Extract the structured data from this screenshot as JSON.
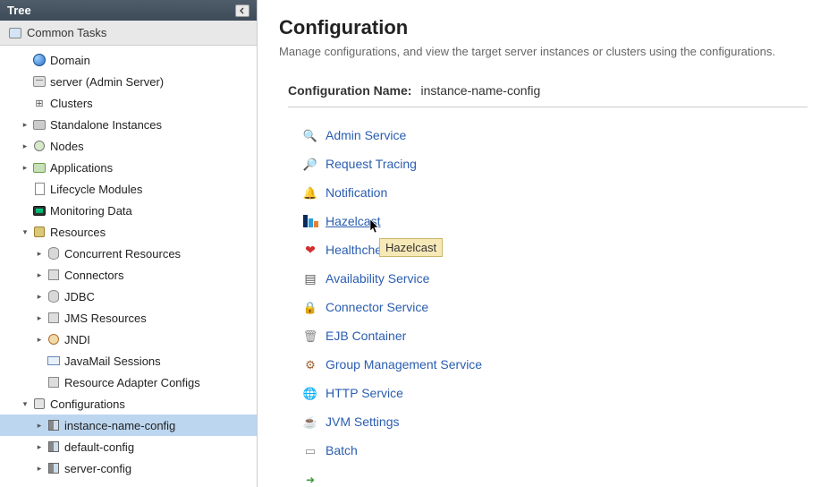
{
  "sidebar": {
    "header": "Tree",
    "common_tasks": "Common Tasks",
    "items": [
      {
        "label": "Domain",
        "indent": 1,
        "icon": "globe",
        "expander": ""
      },
      {
        "label": "server (Admin Server)",
        "indent": 1,
        "icon": "server",
        "expander": ""
      },
      {
        "label": "Clusters",
        "indent": 1,
        "icon": "cluster",
        "expander": ""
      },
      {
        "label": "Standalone Instances",
        "indent": 1,
        "icon": "folder",
        "expander": "▸"
      },
      {
        "label": "Nodes",
        "indent": 1,
        "icon": "nodes",
        "expander": "▸"
      },
      {
        "label": "Applications",
        "indent": 1,
        "icon": "app",
        "expander": "▸"
      },
      {
        "label": "Lifecycle Modules",
        "indent": 1,
        "icon": "doc",
        "expander": ""
      },
      {
        "label": "Monitoring Data",
        "indent": 1,
        "icon": "monitor",
        "expander": ""
      },
      {
        "label": "Resources",
        "indent": 1,
        "icon": "res",
        "expander": "▾"
      },
      {
        "label": "Concurrent Resources",
        "indent": 2,
        "icon": "db",
        "expander": "▸"
      },
      {
        "label": "Connectors",
        "indent": 2,
        "icon": "conn",
        "expander": "▸"
      },
      {
        "label": "JDBC",
        "indent": 2,
        "icon": "db",
        "expander": "▸"
      },
      {
        "label": "JMS Resources",
        "indent": 2,
        "icon": "conn",
        "expander": "▸"
      },
      {
        "label": "JNDI",
        "indent": 2,
        "icon": "jndi",
        "expander": "▸"
      },
      {
        "label": "JavaMail Sessions",
        "indent": 2,
        "icon": "mail",
        "expander": ""
      },
      {
        "label": "Resource Adapter Configs",
        "indent": 2,
        "icon": "conn",
        "expander": ""
      },
      {
        "label": "Configurations",
        "indent": 1,
        "icon": "config",
        "expander": "▾"
      },
      {
        "label": "instance-name-config",
        "indent": 2,
        "icon": "confitem",
        "expander": "▸",
        "selected": true
      },
      {
        "label": "default-config",
        "indent": 2,
        "icon": "confitem",
        "expander": "▸"
      },
      {
        "label": "server-config",
        "indent": 2,
        "icon": "confitem",
        "expander": "▸"
      }
    ]
  },
  "main": {
    "title": "Configuration",
    "subtitle": "Manage configurations, and view the target server instances or clusters using the configurations.",
    "config_name_label": "Configuration Name:",
    "config_name_value": "instance-name-config",
    "tooltip": "Hazelcast",
    "items": [
      {
        "label": "Admin Service",
        "icon": "admin"
      },
      {
        "label": "Request Tracing",
        "icon": "trace"
      },
      {
        "label": "Notification",
        "icon": "bell"
      },
      {
        "label": "Hazelcast",
        "icon": "hz",
        "hovered": true
      },
      {
        "label": "Healthcheck",
        "icon": "heart",
        "truncated": "Healthche"
      },
      {
        "label": "Availability Service",
        "icon": "avail"
      },
      {
        "label": "Connector Service",
        "icon": "connsvc"
      },
      {
        "label": "EJB Container",
        "icon": "ejb"
      },
      {
        "label": "Group Management Service",
        "icon": "group"
      },
      {
        "label": "HTTP Service",
        "icon": "http"
      },
      {
        "label": "JVM Settings",
        "icon": "jvm"
      },
      {
        "label": "Batch",
        "icon": "batch"
      },
      {
        "label": "",
        "icon": "arrow"
      }
    ]
  }
}
